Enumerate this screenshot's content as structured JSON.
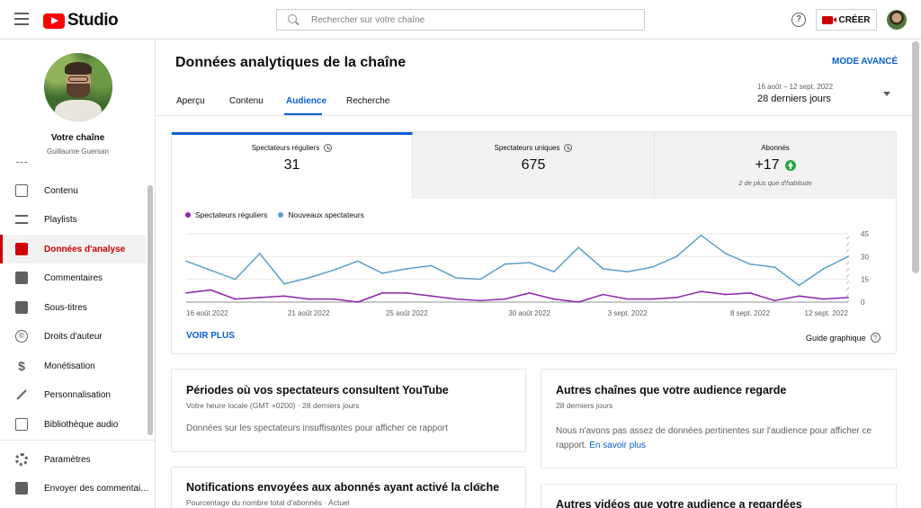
{
  "topbar": {
    "logo_text": "Studio",
    "search_placeholder": "Rechercher sur votre chaîne",
    "help_symbol": "?",
    "create_label": "CRÉER"
  },
  "sidebar": {
    "channel_title": "Votre chaîne",
    "channel_owner": "Guillaume Guersan",
    "items": [
      {
        "label": "Contenu",
        "icon": "video-icon"
      },
      {
        "label": "Playlists",
        "icon": "playlist-icon"
      },
      {
        "label": "Données d'analyse",
        "icon": "analytics-icon",
        "active": true
      },
      {
        "label": "Commentaires",
        "icon": "comment-icon"
      },
      {
        "label": "Sous-titres",
        "icon": "subtitles-icon"
      },
      {
        "label": "Droits d'auteur",
        "icon": "copyright-icon"
      },
      {
        "label": "Monétisation",
        "icon": "dollar-icon"
      },
      {
        "label": "Personnalisation",
        "icon": "wand-icon"
      },
      {
        "label": "Bibliothèque audio",
        "icon": "audio-library-icon"
      }
    ],
    "bottom_items": [
      {
        "label": "Paramètres",
        "icon": "gear-icon"
      },
      {
        "label": "Envoyer des commentai...",
        "icon": "feedback-icon"
      }
    ],
    "copyright_symbol": "©",
    "dollar_symbol": "$"
  },
  "header": {
    "title": "Données analytiques de la chaîne",
    "advanced_mode": "MODE AVANCÉ",
    "tabs": [
      "Aperçu",
      "Contenu",
      "Audience",
      "Recherche"
    ],
    "active_tab": "Audience",
    "date_range": "16 août – 12 sept. 2022",
    "date_label": "28 derniers jours"
  },
  "metrics": [
    {
      "label": "Spectateurs réguliers",
      "value": "31",
      "active": true
    },
    {
      "label": "Spectateurs uniques",
      "value": "675"
    },
    {
      "label": "Abonnés",
      "value": "+17",
      "note": "2 de plus que d'habitude"
    }
  ],
  "chart_data": {
    "type": "line",
    "x_tick_labels": [
      "16 août 2022",
      "21 août 2022",
      "25 août 2022",
      "30 août 2022",
      "3 sept. 2022",
      "8 sept. 2022",
      "12 sept. 2022"
    ],
    "x": [
      "16 août",
      "17 août",
      "18 août",
      "19 août",
      "20 août",
      "21 août",
      "22 août",
      "23 août",
      "24 août",
      "25 août",
      "26 août",
      "27 août",
      "28 août",
      "29 août",
      "30 août",
      "31 août",
      "1 sept.",
      "2 sept.",
      "3 sept.",
      "4 sept.",
      "5 sept.",
      "6 sept.",
      "7 sept.",
      "8 sept.",
      "9 sept.",
      "10 sept.",
      "11 sept.",
      "12 sept."
    ],
    "series": [
      {
        "name": "Spectateurs réguliers",
        "color": "#8e24aa",
        "values": [
          6,
          8,
          2,
          3,
          4,
          2,
          2,
          0,
          6,
          6,
          4,
          2,
          1,
          2,
          6,
          2,
          0,
          5,
          2,
          2,
          3,
          7,
          5,
          6,
          1,
          4,
          2,
          3
        ]
      },
      {
        "name": "Nouveaux spectateurs",
        "color": "#5aa0c8",
        "values": [
          27,
          21,
          15,
          32,
          12,
          16,
          21,
          27,
          19,
          22,
          24,
          16,
          15,
          25,
          26,
          20,
          36,
          22,
          20,
          23,
          30,
          44,
          32,
          25,
          23,
          11,
          22,
          30
        ]
      }
    ],
    "y_ticks": [
      0,
      15,
      30,
      45
    ],
    "ylim": [
      0,
      45
    ],
    "partial_last_day": true,
    "grid": true,
    "legend_position": "top-left"
  },
  "chart_links": {
    "see_more": "VOIR PLUS",
    "guide": "Guide graphique",
    "guide_symbol": "?"
  },
  "cards": {
    "periods": {
      "title": "Périodes où vos spectateurs consultent YouTube",
      "subtitle": "Votre heure locale (GMT +0200) · 28 derniers jours",
      "text": "Données sur les spectateurs insuffisantes pour afficher ce rapport"
    },
    "notifications": {
      "title": "Notifications envoyées aux abonnés ayant activé la cloche",
      "subtitle": "Pourcentage du nombre total d'abonnés · Actuel"
    },
    "other_channels": {
      "title": "Autres chaînes que votre audience regarde",
      "subtitle": "28 derniers jours",
      "text": "Nous n'avons pas assez de données pertinentes sur l'audience pour afficher ce rapport.",
      "link": "En savoir plus"
    },
    "other_videos": {
      "title": "Autres vidéos que votre audience a regardées"
    }
  },
  "colors": {
    "accent": "#065fd4",
    "brand": "#ff0000",
    "active_nav": "#cc0000",
    "positive": "#2ba640"
  }
}
